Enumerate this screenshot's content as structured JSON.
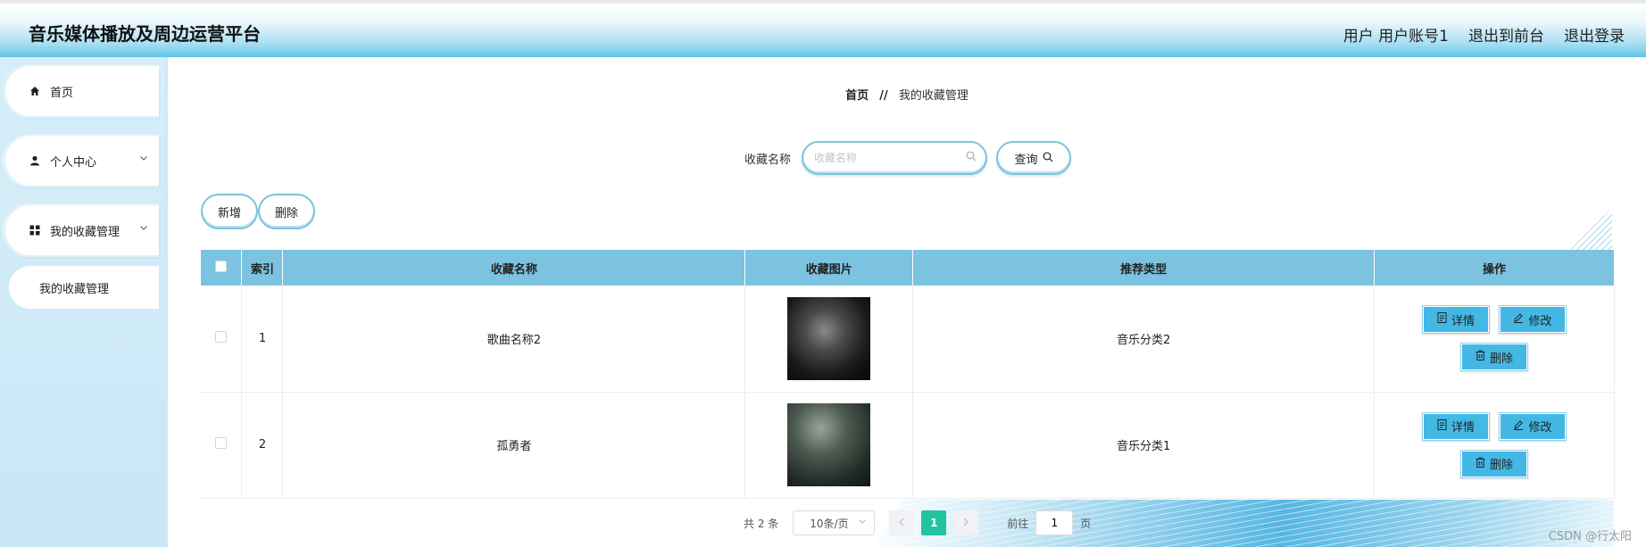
{
  "header": {
    "title": "音乐媒体播放及周边运营平台",
    "user_text": "用户 用户账号1",
    "to_front": "退出到前台",
    "logout": "退出登录"
  },
  "sidebar": {
    "items": [
      {
        "label": "首页",
        "icon": "home-icon"
      },
      {
        "label": "个人中心",
        "icon": "user-icon"
      },
      {
        "label": "我的收藏管理",
        "icon": "grid-icon"
      }
    ],
    "sub_item": "我的收藏管理"
  },
  "breadcrumb": {
    "home": "首页",
    "separator": "//",
    "current": "我的收藏管理"
  },
  "search": {
    "label": "收藏名称",
    "placeholder": "收藏名称",
    "button": "查询"
  },
  "actions": {
    "add": "新增",
    "delete": "删除"
  },
  "table": {
    "columns": [
      "索引",
      "收藏名称",
      "收藏图片",
      "推荐类型",
      "操作"
    ],
    "rows": [
      {
        "index": "1",
        "name": "歌曲名称2",
        "type": "音乐分类2"
      },
      {
        "index": "2",
        "name": "孤勇者",
        "type": "音乐分类1"
      }
    ],
    "row_actions": {
      "detail": "详情",
      "edit": "修改",
      "delete": "删除"
    }
  },
  "pagination": {
    "total": "共 2 条",
    "page_size": "10条/页",
    "current": "1",
    "goto_label": "前往",
    "goto_value": "1",
    "goto_suffix": "页"
  },
  "watermark": "CSDN @行太阳",
  "colors": {
    "header_accent": "#5ec3e6",
    "table_header": "#7bc3e0",
    "action_button": "#43b8e4",
    "active_page": "#22c3a0"
  }
}
